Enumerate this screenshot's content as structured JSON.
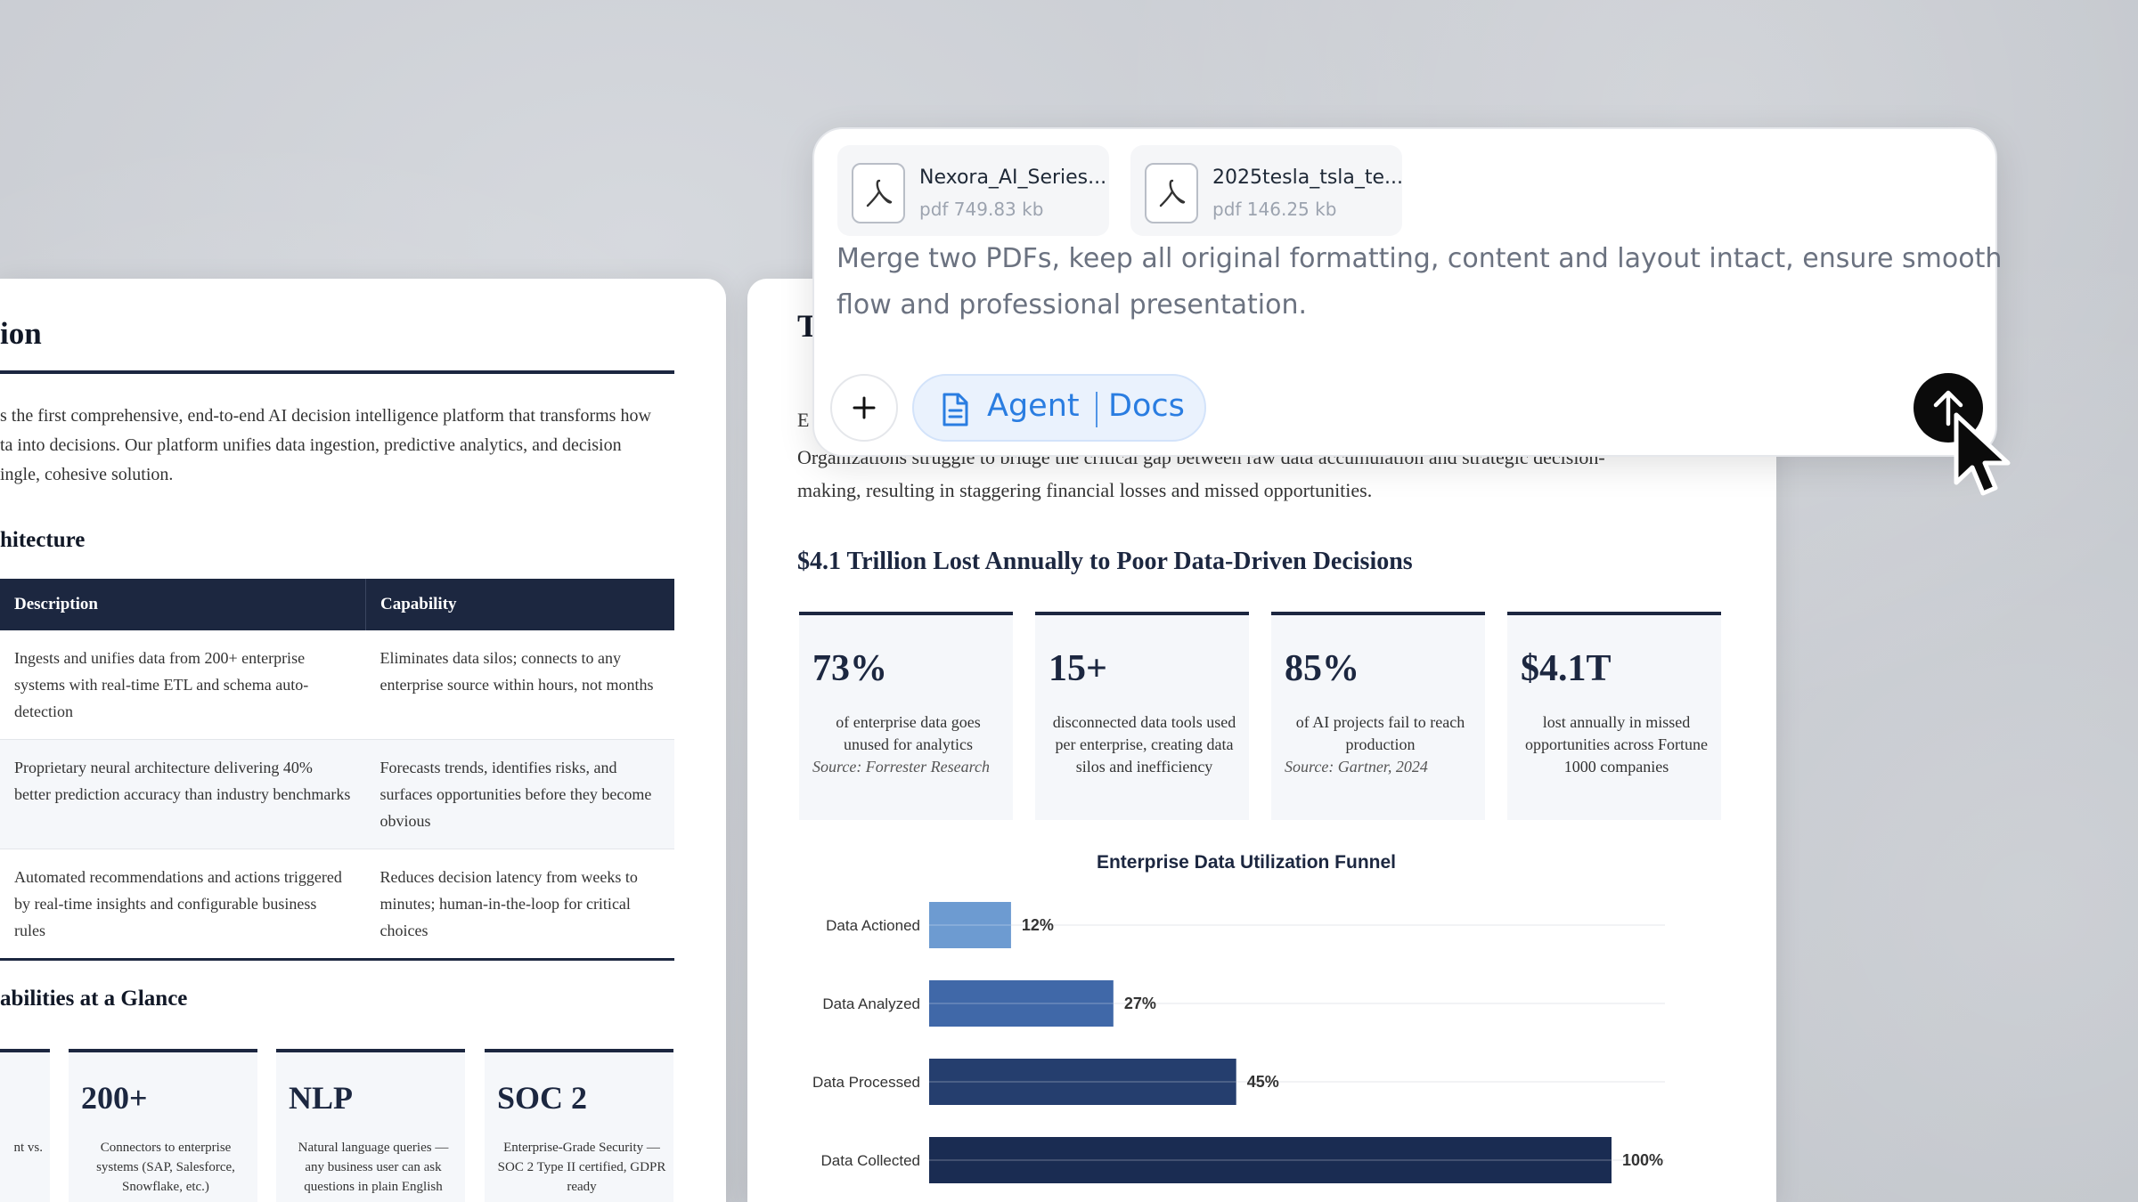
{
  "left_doc": {
    "title_fragment": "ion",
    "intro_lines": [
      "s the first comprehensive, end-to-end AI decision intelligence platform that transforms how",
      "ta into decisions. Our platform unifies data ingestion, predictive analytics, and decision",
      "ingle, cohesive solution."
    ],
    "section_architecture": "hitecture",
    "table": {
      "headers": [
        "Description",
        "Capability"
      ],
      "rows": [
        {
          "description": "Ingests and unifies data from 200+ enterprise systems with real-time ETL and schema auto-detection",
          "capability": "Eliminates data silos; connects to any enterprise source within hours, not months"
        },
        {
          "description": "Proprietary neural architecture delivering 40% better prediction accuracy than industry benchmarks",
          "capability": "Forecasts trends, identifies risks, and surfaces opportunities before they become obvious"
        },
        {
          "description": "Automated recommendations and actions triggered by real-time insights and configurable business rules",
          "capability": "Reduces decision latency from weeks to minutes; human-in-the-loop for critical choices"
        }
      ]
    },
    "section_capabilities": "abilities at a Glance",
    "cards": [
      {
        "big": "",
        "small": "nt vs."
      },
      {
        "big": "200+",
        "small": "Connectors to enterprise systems (SAP, Salesforce, Snowflake, etc.)"
      },
      {
        "big": "NLP",
        "small": "Natural language queries — any business user can ask questions in plain English"
      },
      {
        "big": "SOC 2",
        "small": "Enterprise-Grade Security — SOC 2 Type II certified, GDPR ready"
      }
    ]
  },
  "mid_doc": {
    "title_fragment": "T",
    "line_fragment": "E",
    "para_lines": [
      "Organizations struggle to bridge the critical gap between raw data accumulation and strategic decision-",
      "making, resulting in staggering financial losses and missed opportunities."
    ],
    "heading": "$4.1 Trillion Lost Annually to Poor Data-Driven Decisions",
    "stats": [
      {
        "big": "73%",
        "small": "of enterprise data goes unused for analytics",
        "source": "Source: Forrester Research"
      },
      {
        "big": "15+",
        "small": "disconnected data tools used per enterprise, creating data silos and inefficiency",
        "source": ""
      },
      {
        "big": "85%",
        "small": "of AI projects fail to reach production",
        "source": "Source: Gartner, 2024"
      },
      {
        "big": "$4.1T",
        "small": "lost annually in missed opportunities across Fortune 1000 companies",
        "source": ""
      }
    ]
  },
  "chart_data": {
    "type": "bar",
    "orientation": "horizontal",
    "title": "Enterprise Data Utilization Funnel",
    "categories": [
      "Data Actioned",
      "Data Analyzed",
      "Data Processed",
      "Data Collected"
    ],
    "values": [
      12,
      27,
      45,
      100
    ],
    "value_suffix": "%",
    "xlim": [
      0,
      100
    ],
    "colors": [
      "#6d9bd1",
      "#4068a8",
      "#253e6e",
      "#1a2c52"
    ],
    "grid": true
  },
  "composer": {
    "files": [
      {
        "name": "Nexora_AI_Series...",
        "meta": "pdf 749.83 kb",
        "icon": "pdf-icon"
      },
      {
        "name": "2025tesla_tsla_te...",
        "meta": "pdf 146.25 kb",
        "icon": "pdf-icon"
      }
    ],
    "prompt_lines": [
      "Merge two PDFs, keep all original formatting, content and layout intact, ensure smooth",
      "flow and professional presentation."
    ],
    "agent_label": "Agent",
    "agent_mode": "Docs",
    "colors": {
      "accent": "#2a7de1",
      "send_bg": "#0b0b0b"
    }
  }
}
